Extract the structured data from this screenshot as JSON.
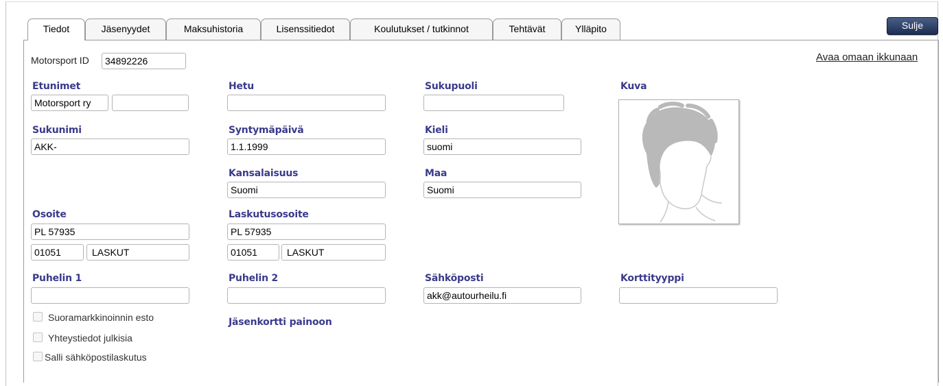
{
  "tabs": [
    {
      "label": "Tiedot",
      "active": true
    },
    {
      "label": "Jäsenyydet"
    },
    {
      "label": "Maksuhistoria"
    },
    {
      "label": "Lisenssitiedot"
    },
    {
      "label": "Koulutukset / tutkinnot"
    },
    {
      "label": "Tehtävät"
    },
    {
      "label": "Ylläpito"
    }
  ],
  "close_button": "Sulje",
  "open_window_link": "Avaa omaan ikkunaan",
  "motorsport_id": {
    "label": "Motorsport ID",
    "value": "34892226"
  },
  "fields": {
    "etunimet": {
      "label": "Etunimet",
      "value": "Motorsport ry",
      "value2": ""
    },
    "hetu": {
      "label": "Hetu",
      "value": ""
    },
    "sukupuoli": {
      "label": "Sukupuoli",
      "value": ""
    },
    "kuva": {
      "label": "Kuva"
    },
    "sukunimi": {
      "label": "Sukunimi",
      "value": "AKK-"
    },
    "syntymapaiva": {
      "label": "Syntymäpäivä",
      "value": "1.1.1999"
    },
    "kieli": {
      "label": "Kieli",
      "value": "suomi"
    },
    "kansalaisuus": {
      "label": "Kansalaisuus",
      "value": "Suomi"
    },
    "maa": {
      "label": "Maa",
      "value": "Suomi"
    },
    "osoite": {
      "label": "Osoite",
      "street": "PL 57935",
      "postcode": "01051",
      "city": "LASKUT"
    },
    "laskutusosoite": {
      "label": "Laskutusosoite",
      "street": "PL 57935",
      "postcode": "01051",
      "city": "LASKUT"
    },
    "puhelin1": {
      "label": "Puhelin 1",
      "value": ""
    },
    "puhelin2": {
      "label": "Puhelin 2",
      "value": ""
    },
    "sahkoposti": {
      "label": "Sähköposti",
      "value": "akk@autourheilu.fi"
    },
    "korttityyppi": {
      "label": "Korttityyppi",
      "value": ""
    }
  },
  "checkboxes": [
    {
      "label": "Suoramarkkinoinnin esto",
      "checked": false
    },
    {
      "label": "Yhteystiedot julkisia",
      "checked": false
    },
    {
      "label": "Salli sähköpostilaskutus",
      "checked": false
    }
  ],
  "jasenkortti_label": "Jäsenkortti painoon",
  "icons": {
    "photo": "person-silhouette-icon"
  }
}
